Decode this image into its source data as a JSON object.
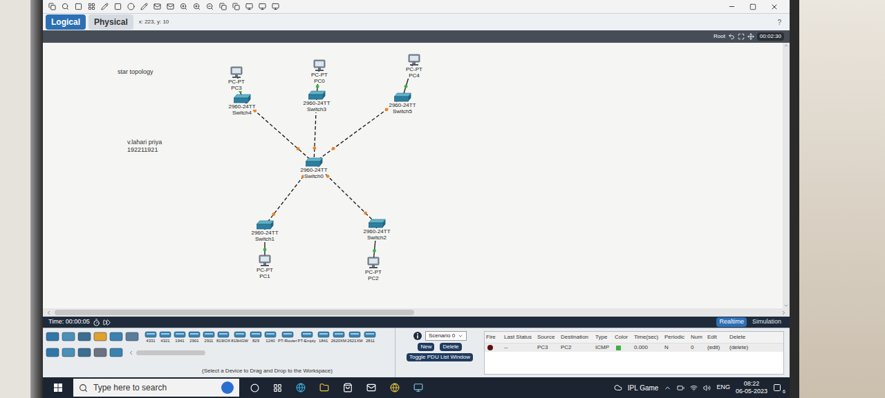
{
  "tabs": [
    {
      "label": "Logical",
      "selected": true
    },
    {
      "label": "Physical",
      "selected": false
    }
  ],
  "coordinates": "x: 223, y: 10",
  "help": "?",
  "header": {
    "path": "Root",
    "clock": "00:02:30"
  },
  "canvas": {
    "notes": [
      "star topology",
      "v.lahari priya",
      "192211921"
    ],
    "nodes": [
      {
        "model": "2960-24TT",
        "name": "Switch0",
        "kind": "switch"
      },
      {
        "model": "2960-24TT",
        "name": "Switch4",
        "kind": "switch"
      },
      {
        "model": "2960-24TT",
        "name": "Switch3",
        "kind": "switch"
      },
      {
        "model": "2960-24TT",
        "name": "Switch5",
        "kind": "switch"
      },
      {
        "model": "2960-24TT",
        "name": "Switch1",
        "kind": "switch"
      },
      {
        "model": "2960-24TT",
        "name": "Switch2",
        "kind": "switch"
      },
      {
        "model": "PC-PT",
        "name": "PC3",
        "kind": "pc"
      },
      {
        "model": "PC-PT",
        "name": "PC0",
        "kind": "pc"
      },
      {
        "model": "PC-PT",
        "name": "PC4",
        "kind": "pc"
      },
      {
        "model": "PC-PT",
        "name": "PC1",
        "kind": "pc"
      },
      {
        "model": "PC-PT",
        "name": "PC2",
        "kind": "pc"
      }
    ],
    "links": [
      {
        "from": "Switch0",
        "to": "Switch4",
        "kind": "crossover"
      },
      {
        "from": "Switch0",
        "to": "Switch3",
        "kind": "crossover"
      },
      {
        "from": "Switch0",
        "to": "Switch5",
        "kind": "crossover"
      },
      {
        "from": "Switch0",
        "to": "Switch1",
        "kind": "crossover"
      },
      {
        "from": "Switch0",
        "to": "Switch2",
        "kind": "crossover"
      },
      {
        "from": "PC3",
        "to": "Switch4",
        "kind": "straight"
      },
      {
        "from": "PC0",
        "to": "Switch3",
        "kind": "straight"
      },
      {
        "from": "PC4",
        "to": "Switch5",
        "kind": "straight"
      },
      {
        "from": "PC1",
        "to": "Switch1",
        "kind": "straight"
      },
      {
        "from": "PC2",
        "to": "Switch2",
        "kind": "straight"
      }
    ]
  },
  "time_bar": {
    "time": "Time: 00:00:05",
    "modes": [
      {
        "label": "Realtime",
        "selected": true
      },
      {
        "label": "Simulation",
        "selected": false
      }
    ]
  },
  "device_panel": {
    "devices": [
      "4331",
      "4321",
      "1941",
      "2901",
      "2911",
      "819IOX",
      "819HGW",
      "829",
      "1240",
      "PT-Router",
      "PT-Empty",
      "1841",
      "2620XM",
      "2621XM",
      "2811"
    ],
    "hint": "(Select a Device to Drag and Drop to the Workspace)"
  },
  "scenario": {
    "name": "Scenario 0",
    "buttons": [
      "New",
      "Delete"
    ],
    "toggle": "Toggle PDU List Window",
    "columns": [
      "Fire",
      "Last Status",
      "Source",
      "Destination",
      "Type",
      "Color",
      "Time(sec)",
      "Periodic",
      "Num",
      "Edit",
      "Delete"
    ],
    "rows": [
      {
        "last_status": "--",
        "source": "PC3",
        "destination": "PC2",
        "type": "ICMP",
        "color": "#3cb043",
        "time": "0.000",
        "periodic": "N",
        "num": "0",
        "edit": "(edit)",
        "delete": "(delete)"
      }
    ]
  },
  "taskbar": {
    "search": "Type here to search",
    "weather": "IPL Game",
    "language": "ENG",
    "time": "08:22",
    "date": "06-05-2023",
    "notifications": "6"
  }
}
